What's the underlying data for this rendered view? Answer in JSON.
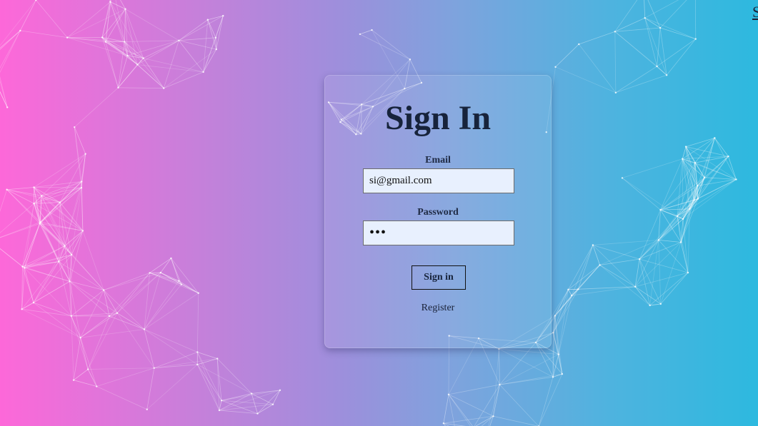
{
  "corner_link": "S",
  "form": {
    "title": "Sign In",
    "email_label": "Email",
    "email_value": "si@gmail.com",
    "password_label": "Password",
    "password_value": "•••",
    "submit_label": "Sign in",
    "register_link": "Register"
  }
}
